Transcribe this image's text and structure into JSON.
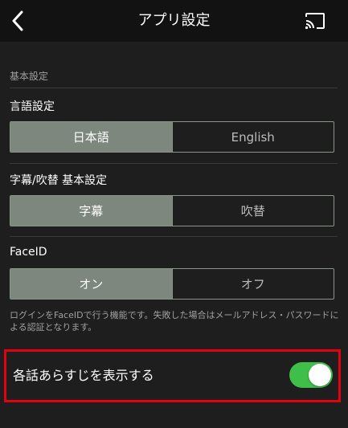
{
  "header": {
    "title": "アプリ設定",
    "back_icon": "chevron-left-icon",
    "cast_icon": "cast-icon"
  },
  "section": {
    "label": "基本設定"
  },
  "language": {
    "label": "言語設定",
    "options": [
      "日本語",
      "English"
    ],
    "selected": "日本語"
  },
  "subtitle": {
    "label": "字幕/吹替 基本設定",
    "options": [
      "字幕",
      "吹替"
    ],
    "selected": "字幕"
  },
  "faceid": {
    "label": "FaceID",
    "options": [
      "オン",
      "オフ"
    ],
    "selected": "オン",
    "note": "ログインをFaceIDで行う機能です。失敗した場合はメールアドレス・パスワードによる認証となります。"
  },
  "synopsis": {
    "label": "各話あらすじを表示する",
    "enabled": true
  },
  "colors": {
    "background": "#1e1e1e",
    "header": "#121212",
    "selected_segment": "#7e877d",
    "toggle_on": "#3fbe4a",
    "highlight_border": "#e50012"
  }
}
